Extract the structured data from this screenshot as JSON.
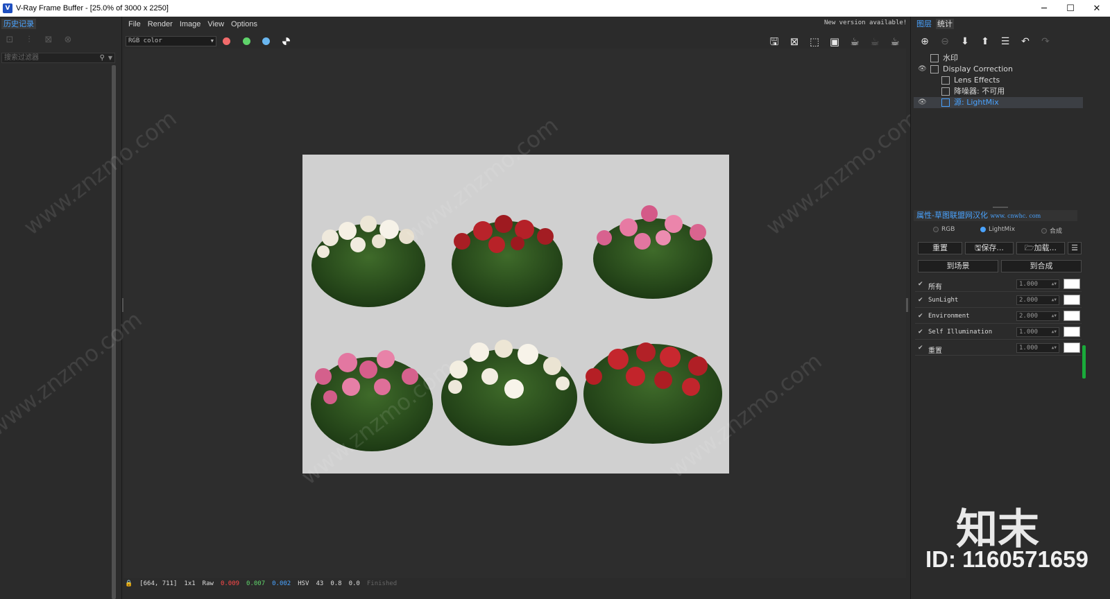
{
  "window": {
    "title": "V-Ray Frame Buffer - [25.0% of 3000 x 2250]",
    "app_icon": "V",
    "controls": {
      "minimize": "─",
      "maximize": "☐",
      "close": "✕"
    }
  },
  "left_panel": {
    "tab": "历史记录",
    "toolbar": [
      "save-history-icon",
      "compare-icon",
      "load-icon",
      "remove-icon"
    ],
    "filter_placeholder": "搜索过滤器"
  },
  "menu": [
    "File",
    "Render",
    "Image",
    "View",
    "Options"
  ],
  "notice": "New version available!",
  "channel": {
    "selected": "RGB color"
  },
  "color_dots": [
    {
      "name": "red-channel",
      "color": "#f26b6b"
    },
    {
      "name": "green-channel",
      "color": "#5fd36a"
    },
    {
      "name": "blue-channel",
      "color": "#6ab7f0"
    }
  ],
  "render_tools": [
    "save-image-icon",
    "clear-image-icon",
    "region-render-icon",
    "track-mouse-icon",
    "render-icon",
    "stop-render-icon",
    "render-interactive-icon"
  ],
  "status": {
    "coords": "[664, 711]",
    "zoom": "1x1",
    "mode": "Raw",
    "r": "0.009",
    "g": "0.007",
    "b": "0.002",
    "color_mode": "HSV",
    "h": "43",
    "s": "0.8",
    "v": "0.0",
    "state": "Finished",
    "r_color": "#ff4a4a",
    "g_color": "#5fd36a",
    "b_color": "#4aa3ff"
  },
  "right_panel": {
    "tabs": [
      "图层",
      "统计"
    ],
    "layers": [
      {
        "label": "水印",
        "eye": false,
        "indent": 1,
        "selected": false
      },
      {
        "label": "Display Correction",
        "eye": true,
        "indent": 1,
        "selected": false
      },
      {
        "label": "Lens Effects",
        "eye": false,
        "indent": 2,
        "selected": false
      },
      {
        "label": "降噪器: 不可用",
        "eye": false,
        "indent": 2,
        "selected": false
      },
      {
        "label": "源: LightMix",
        "eye": true,
        "indent": 2,
        "selected": true
      }
    ],
    "props_title": "属性-草图联盟网汉化",
    "props_sub": "www. cnwhc. com",
    "mode_options": [
      {
        "label": "RGB",
        "checked": false
      },
      {
        "label": "LightMix",
        "checked": true
      },
      {
        "label": "合成",
        "checked": false
      }
    ],
    "buttons": {
      "reset": "重置",
      "save": "保存...",
      "load": "加载...",
      "to_scene": "到场景",
      "to_composite": "到合成"
    },
    "lightmix": [
      {
        "label": "所有",
        "value": "1.000",
        "checked": true
      },
      {
        "label": "SunLight",
        "value": "2.000",
        "checked": true
      },
      {
        "label": "Environment",
        "value": "2.000",
        "checked": true
      },
      {
        "label": "Self Illumination",
        "value": "1.000",
        "checked": true
      },
      {
        "label": "重置",
        "value": "1.000",
        "checked": true
      }
    ]
  },
  "watermark": {
    "logo": "知末",
    "id": "ID: 1160571659",
    "site": "www.znzmo.com",
    "brand": "知末网"
  }
}
